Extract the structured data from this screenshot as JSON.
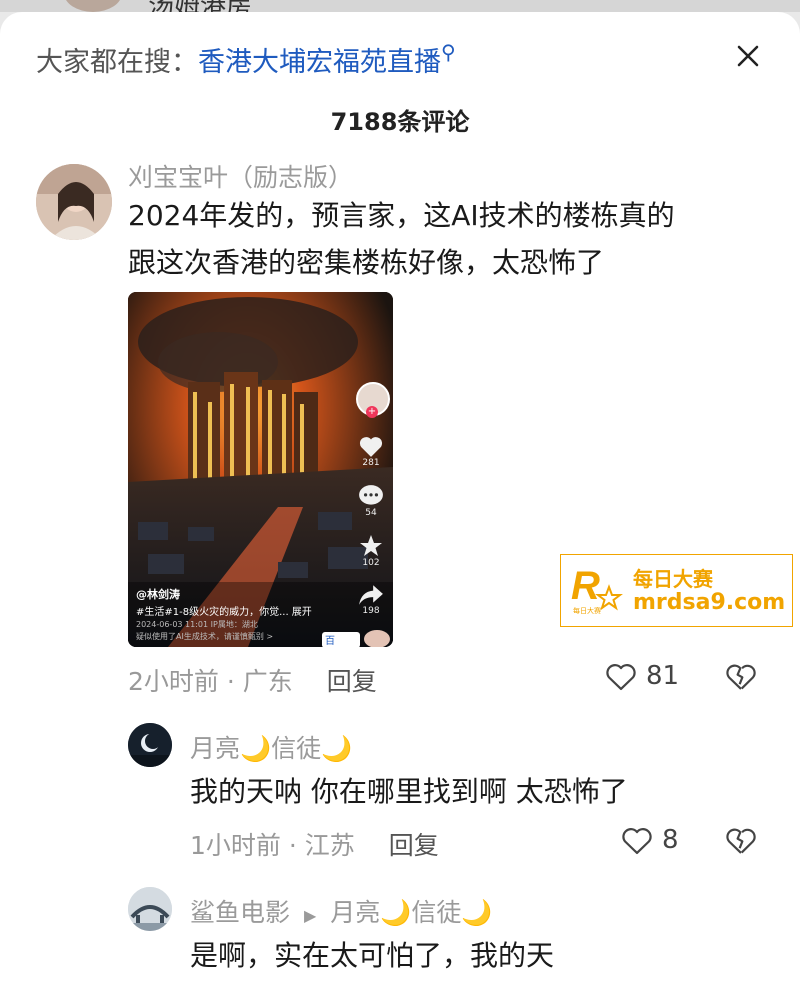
{
  "top": {
    "partial_title": "汤姆港房"
  },
  "search": {
    "prefix": "大家都在搜：",
    "query": "香港大埔宏福苑直播"
  },
  "comments_header": {
    "count": "7188条评论"
  },
  "comment1": {
    "username": "刈宝宝叶（励志版）",
    "text_line1": "2024年发的，预言家，这AI技术的楼栋真的",
    "text_line2": "跟这次香港的密集楼栋好像，太恐怖了",
    "time": "2小时前 · 广东",
    "reply": "回复",
    "likes": "81",
    "media": {
      "author": "@林剑涛",
      "caption": "#生活#1-8级火灾的威力，你觉... 展开",
      "date_line": "2024-06-03 11:01  IP属地：湖北",
      "notice": "疑似使用了AI生成技术，请谨慎甄别 >",
      "like_count": "281",
      "comment_count": "54",
      "fav_count": "102",
      "share_count": "198",
      "corner_tag": "百"
    }
  },
  "reply1": {
    "username": "月亮🌙信徒🌙",
    "text": "我的天呐 你在哪里找到啊 太恐怖了",
    "time": "1小时前 · 江苏",
    "reply": "回复",
    "likes": "8"
  },
  "reply2": {
    "username": "鲨鱼电影",
    "reply_to": "月亮🌙信徒🌙",
    "text": "是啊，实在太可怕了，我的天"
  },
  "watermark": {
    "brand_cn": "每日大赛",
    "url": "mrdsa9.com",
    "logo_letter": "R",
    "logo_sub": "每日大赛"
  },
  "colors": {
    "link": "#1f5bbf",
    "watermark_orange": "#f1a400",
    "text": "#1a1a1a",
    "meta": "#999999"
  }
}
